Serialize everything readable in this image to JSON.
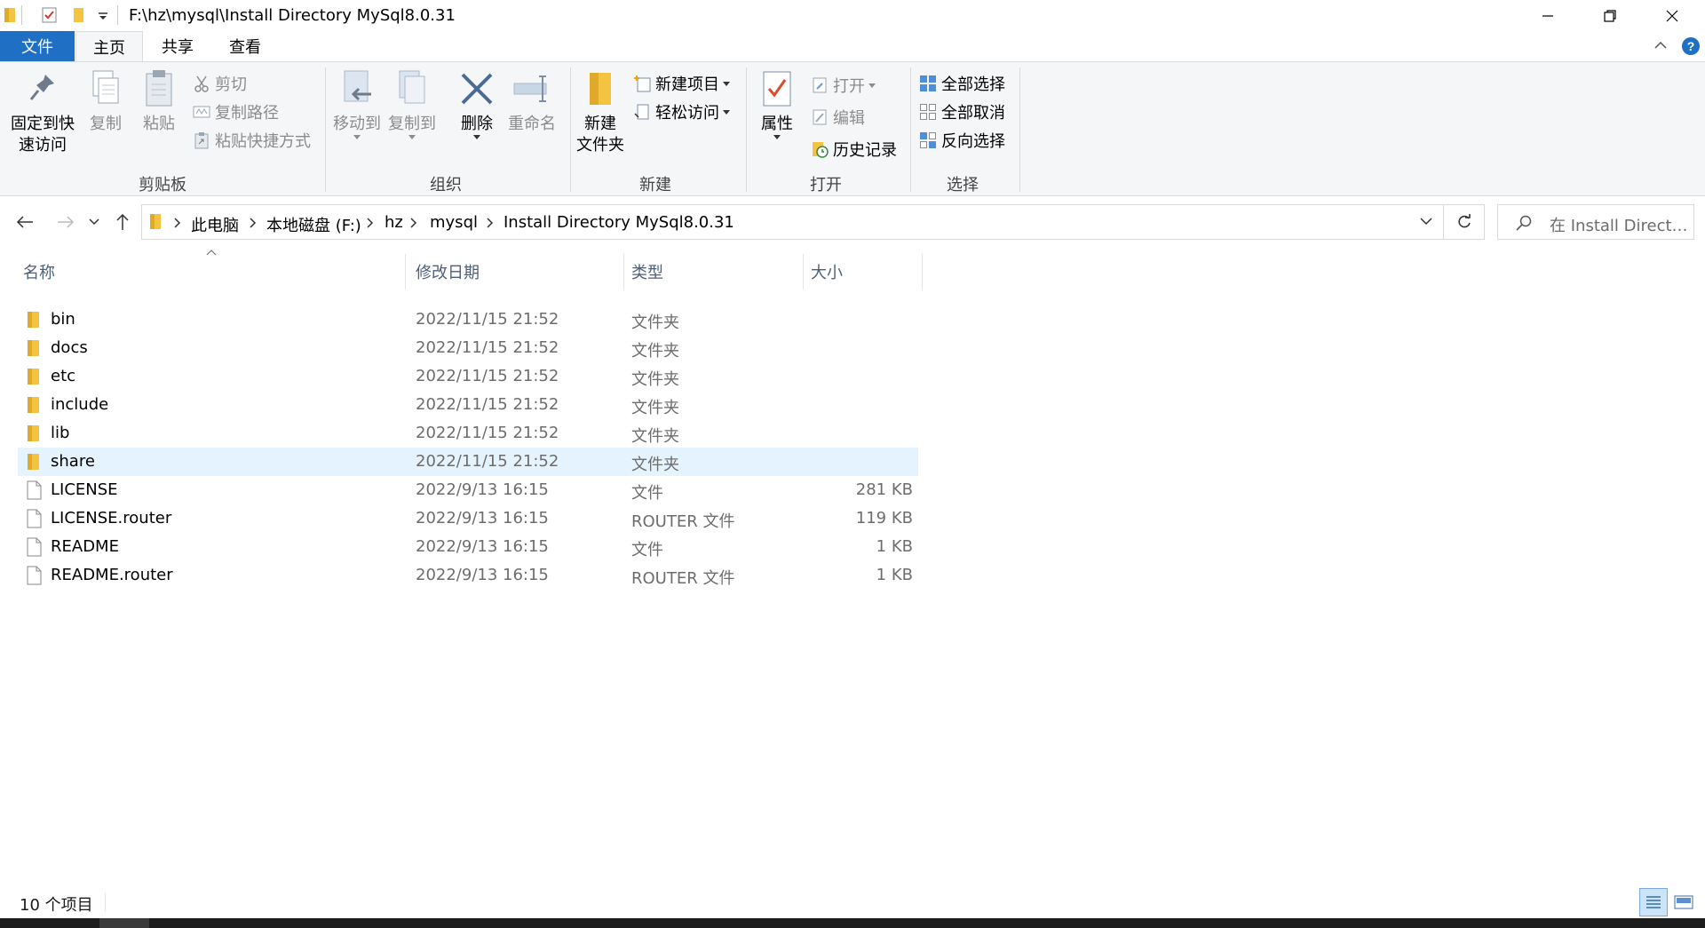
{
  "window": {
    "path_title": "F:\\hz\\mysql\\Install Directory MySql8.0.31"
  },
  "tabs": {
    "file": "文件",
    "home": "主页",
    "share": "共享",
    "view": "查看"
  },
  "ribbon": {
    "clipboard": {
      "group_label": "剪贴板",
      "pin_line1": "固定到快",
      "pin_line2": "速访问",
      "copy": "复制",
      "paste": "粘贴",
      "cut": "剪切",
      "copy_path": "复制路径",
      "paste_shortcut": "粘贴快捷方式"
    },
    "organize": {
      "group_label": "组织",
      "move_to": "移动到",
      "copy_to": "复制到",
      "delete": "删除",
      "rename": "重命名"
    },
    "new": {
      "group_label": "新建",
      "new_folder_line1": "新建",
      "new_folder_line2": "文件夹",
      "new_item": "新建项目",
      "easy_access": "轻松访问"
    },
    "open": {
      "group_label": "打开",
      "properties": "属性",
      "open": "打开",
      "edit": "编辑",
      "history": "历史记录"
    },
    "select": {
      "group_label": "选择",
      "select_all": "全部选择",
      "select_none": "全部取消",
      "invert": "反向选择"
    }
  },
  "address": {
    "crumbs": [
      "此电脑",
      "本地磁盘 (F:)",
      "hz",
      "mysql",
      "Install Directory MySql8.0.31"
    ],
    "search_placeholder": "在 Install Director..."
  },
  "columns": {
    "name": "名称",
    "date": "修改日期",
    "type": "类型",
    "size": "大小"
  },
  "files": [
    {
      "name": "bin",
      "date": "2022/11/15 21:52",
      "type": "文件夹",
      "size": "",
      "kind": "folder"
    },
    {
      "name": "docs",
      "date": "2022/11/15 21:52",
      "type": "文件夹",
      "size": "",
      "kind": "folder"
    },
    {
      "name": "etc",
      "date": "2022/11/15 21:52",
      "type": "文件夹",
      "size": "",
      "kind": "folder"
    },
    {
      "name": "include",
      "date": "2022/11/15 21:52",
      "type": "文件夹",
      "size": "",
      "kind": "folder"
    },
    {
      "name": "lib",
      "date": "2022/11/15 21:52",
      "type": "文件夹",
      "size": "",
      "kind": "folder"
    },
    {
      "name": "share",
      "date": "2022/11/15 21:52",
      "type": "文件夹",
      "size": "",
      "kind": "folder",
      "selected": true
    },
    {
      "name": "LICENSE",
      "date": "2022/9/13 16:15",
      "type": "文件",
      "size": "281 KB",
      "kind": "file"
    },
    {
      "name": "LICENSE.router",
      "date": "2022/9/13 16:15",
      "type": "ROUTER 文件",
      "size": "119 KB",
      "kind": "file"
    },
    {
      "name": "README",
      "date": "2022/9/13 16:15",
      "type": "文件",
      "size": "1 KB",
      "kind": "file"
    },
    {
      "name": "README.router",
      "date": "2022/9/13 16:15",
      "type": "ROUTER 文件",
      "size": "1 KB",
      "kind": "file"
    }
  ],
  "status": {
    "item_count": "10 个项目"
  },
  "colors": {
    "accent": "#1f6fc5",
    "folder": "#f5c342",
    "selected_row": "#e5f3ff"
  }
}
